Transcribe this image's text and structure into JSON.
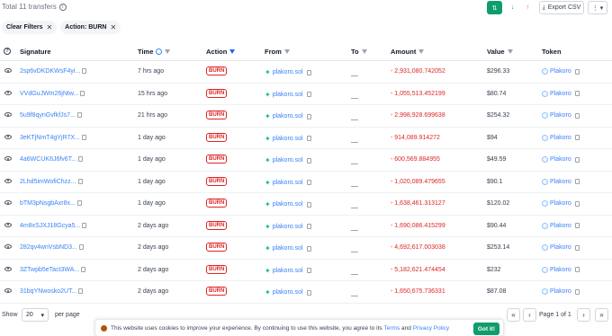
{
  "header": {
    "total_label": "Total 11 transfers",
    "export_label": "Export CSV"
  },
  "filters": {
    "clear_label": "Clear Filters",
    "chips": [
      {
        "label": "Action: BURN"
      }
    ]
  },
  "columns": {
    "signature": "Signature",
    "time": "Time",
    "action": "Action",
    "from": "From",
    "to": "To",
    "amount": "Amount",
    "value": "Value",
    "token": "Token"
  },
  "rows": [
    {
      "signature": "2sp6vDKDKWsF4yi...",
      "time": "7 hrs ago",
      "action": "BURN",
      "from": "plakoro.sol",
      "to": "__",
      "amount": "- 2,931,080.742052",
      "value": "$296.33",
      "token": "Plakoro"
    },
    {
      "signature": "VVdGuJWm26jNtw...",
      "time": "15 hrs ago",
      "action": "BURN",
      "from": "plakoro.sol",
      "to": "__",
      "amount": "- 1,055,513.452199",
      "value": "$80.74",
      "token": "Plakoro"
    },
    {
      "signature": "5u9f8qynGvfkfJs7...",
      "time": "21 hrs ago",
      "action": "BURN",
      "from": "plakoro.sol",
      "to": "__",
      "amount": "- 2,998,928.699638",
      "value": "$254.32",
      "token": "Plakoro"
    },
    {
      "signature": "3eKTjNmT4gYjR7X...",
      "time": "1 day ago",
      "action": "BURN",
      "from": "plakoro.sol",
      "to": "__",
      "amount": "- 914,089.914272",
      "value": "$94",
      "token": "Plakoro"
    },
    {
      "signature": "4a6WCUK6J6fv6T...",
      "time": "1 day ago",
      "action": "BURN",
      "from": "plakoro.sol",
      "to": "__",
      "amount": "- 600,569.884955",
      "value": "$49.59",
      "token": "Plakoro"
    },
    {
      "signature": "2Lhd5imWofiChzz...",
      "time": "1 day ago",
      "action": "BURN",
      "from": "plakoro.sol",
      "to": "__",
      "amount": "- 1,020,089.479655",
      "value": "$90.1",
      "token": "Plakoro"
    },
    {
      "signature": "bTM3pNsgbAxr8x...",
      "time": "1 day ago",
      "action": "BURN",
      "from": "plakoro.sol",
      "to": "__",
      "amount": "- 1,638,461.313127",
      "value": "$120.02",
      "token": "Plakoro"
    },
    {
      "signature": "4m8xSJXJ18Gcya5...",
      "time": "2 days ago",
      "action": "BURN",
      "from": "plakoro.sol",
      "to": "__",
      "amount": "- 1,690,086.415299",
      "value": "$90.44",
      "token": "Plakoro"
    },
    {
      "signature": "282qv4wnVsbND3...",
      "time": "2 days ago",
      "action": "BURN",
      "from": "plakoro.sol",
      "to": "__",
      "amount": "- 4,692,617.003038",
      "value": "$253.14",
      "token": "Plakoro"
    },
    {
      "signature": "3ZTwpb5eTact3WA...",
      "time": "2 days ago",
      "action": "BURN",
      "from": "plakoro.sol",
      "to": "__",
      "amount": "- 5,182,621.474454",
      "value": "$232",
      "token": "Plakoro"
    },
    {
      "signature": "31bqYNwosko2UT...",
      "time": "2 days ago",
      "action": "BURN",
      "from": "plakoro.sol",
      "to": "__",
      "amount": "- 1,650,675.736331",
      "value": "$87.08",
      "token": "Plakoro"
    }
  ],
  "pagination": {
    "show_label": "Show",
    "page_size": "20",
    "per_page_label": "per page",
    "page_label": "Page 1 of 1"
  },
  "cookie": {
    "text": "This website uses cookies to improve your experience. By continuing to use this website, you agree to its",
    "terms": "Terms",
    "and": "and",
    "privacy": "Privacy Policy",
    "button": "Got it!"
  },
  "colors": {
    "accent": "#0f9d6b",
    "link": "#3b82f6",
    "burn": "#dc2626"
  }
}
